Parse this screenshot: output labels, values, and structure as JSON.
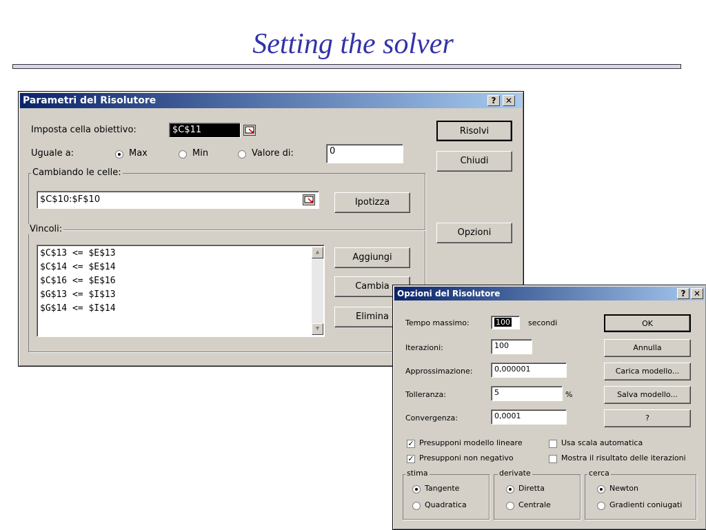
{
  "slide": {
    "title": "Setting the solver"
  },
  "main_dialog": {
    "title": "Parametri del Risolutore",
    "help_btn": "?",
    "close_btn": "✕",
    "target_label": "Imposta cella obiettivo:",
    "target_value": "$C$11",
    "equal_label": "Uguale a:",
    "radio_max": "Max",
    "radio_min": "Min",
    "radio_value": "Valore di:",
    "value_field": "0",
    "changing_label": "Cambiando le celle:",
    "changing_value": "$C$10:$F$10",
    "guess_btn": "Ipotizza",
    "constraints_label": "Vincoli:",
    "constraints": [
      "$C$13 <= $E$13",
      "$C$14 <= $E$14",
      "$C$16 <= $E$16",
      "$G$13 <= $I$13",
      "$G$14 <= $I$14"
    ],
    "solve_btn": "Risolvi",
    "close_label": "Chiudi",
    "options_btn": "Opzioni",
    "add_btn": "Aggiungi",
    "change_btn": "Cambia",
    "delete_btn": "Elimina"
  },
  "options_dialog": {
    "title": "Opzioni del Risolutore",
    "help_btn": "?",
    "close_btn": "✕",
    "max_time_label": "Tempo massimo:",
    "max_time_value": "100",
    "seconds": "secondi",
    "iterations_label": "Iterazioni:",
    "iterations_value": "100",
    "precision_label": "Approssimazione:",
    "precision_value": "0,000001",
    "tolerance_label": "Tolleranza:",
    "tolerance_value": "5",
    "percent": "%",
    "convergence_label": "Convergenza:",
    "convergence_value": "0,0001",
    "ok_btn": "OK",
    "cancel_btn": "Annulla",
    "load_btn": "Carica modello...",
    "save_btn": "Salva modello...",
    "help2_btn": "?",
    "chk_linear": "Presupponi modello lineare",
    "chk_scale": "Usa scala automatica",
    "chk_nonneg": "Presupponi non negativo",
    "chk_show": "Mostra il risultato delle iterazioni",
    "group_estimate": "stima",
    "estimate_tangent": "Tangente",
    "estimate_quadratic": "Quadratica",
    "group_derivatives": "derivate",
    "deriv_forward": "Diretta",
    "deriv_central": "Centrale",
    "group_search": "cerca",
    "search_newton": "Newton",
    "search_conjugate": "Gradienti coniugati"
  }
}
